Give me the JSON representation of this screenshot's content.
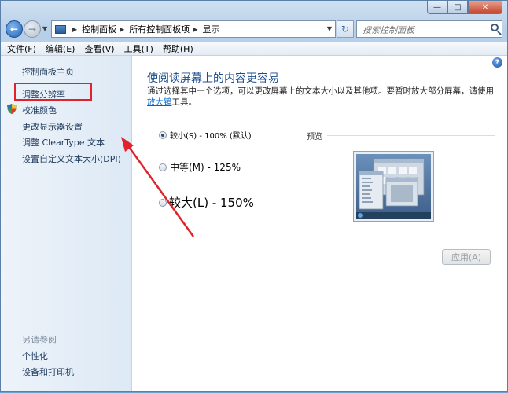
{
  "window": {
    "minimize_label": "—",
    "maximize_label": "□",
    "close_label": "✕"
  },
  "nav": {
    "back_label": "←",
    "forward_label": "→",
    "history_label": "▼",
    "breadcrumbs": [
      "控制面板",
      "所有控制面板项",
      "显示"
    ],
    "refresh_label": "↻",
    "search_placeholder": "搜索控制面板"
  },
  "menu": [
    "文件(F)",
    "编辑(E)",
    "查看(V)",
    "工具(T)",
    "帮助(H)"
  ],
  "sidebar": {
    "items": [
      {
        "label": "控制面板主页"
      },
      {
        "label": "调整分辨率",
        "highlighted": true
      },
      {
        "label": "校准颜色",
        "icon": "shield-icon"
      },
      {
        "label": "更改显示器设置"
      },
      {
        "label": "调整 ClearType 文本"
      },
      {
        "label": "设置自定义文本大小(DPI)"
      }
    ],
    "see_also_title": "另请参阅",
    "see_also": [
      {
        "label": "个性化"
      },
      {
        "label": "设备和打印机"
      }
    ]
  },
  "main": {
    "help_label": "?",
    "heading": "使阅读屏幕上的内容更容易",
    "desc_text": "通过选择其中一个选项，可以更改屏幕上的文本大小以及其他项。要暂时放大部分屏幕，请使用",
    "desc_link": "放大镜",
    "desc_suffix": "工具。",
    "options": [
      {
        "label": "较小(S) - 100% (默认)",
        "selected": true
      },
      {
        "label": "中等(M) - 125%",
        "selected": false
      },
      {
        "label": "较大(L) - 150%",
        "selected": false
      }
    ],
    "preview_label": "预览",
    "apply_label": "应用(A)"
  },
  "annotation": {
    "box_color": "#e0232b",
    "arrow_color": "#e0232b"
  }
}
